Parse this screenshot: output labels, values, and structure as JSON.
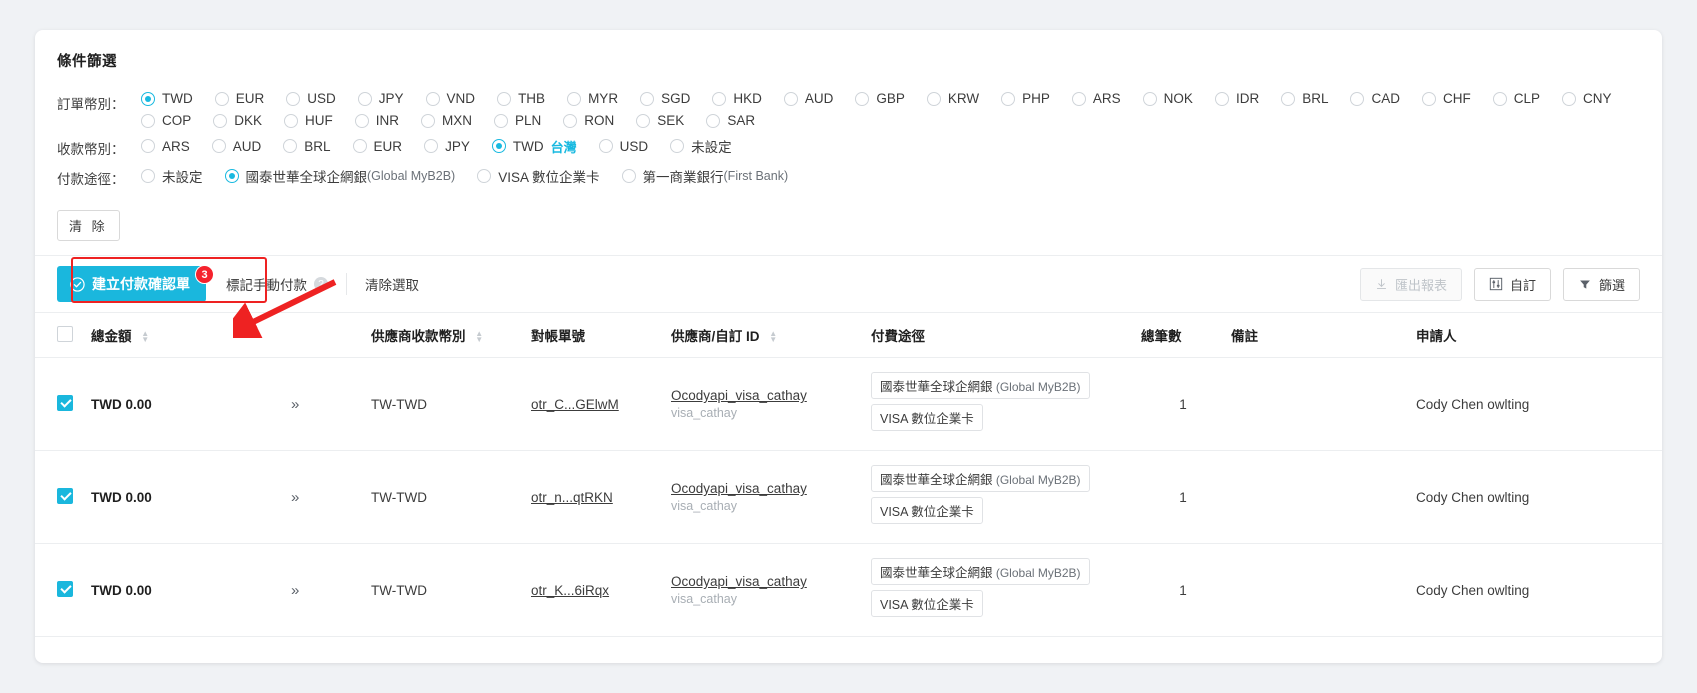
{
  "filter": {
    "title": "條件篩選",
    "order_currency_label": "訂單幣別：",
    "order_currencies": [
      {
        "code": "TWD",
        "selected": true
      },
      {
        "code": "EUR",
        "selected": false
      },
      {
        "code": "USD",
        "selected": false
      },
      {
        "code": "JPY",
        "selected": false
      },
      {
        "code": "VND",
        "selected": false
      },
      {
        "code": "THB",
        "selected": false
      },
      {
        "code": "MYR",
        "selected": false
      },
      {
        "code": "SGD",
        "selected": false
      },
      {
        "code": "HKD",
        "selected": false
      },
      {
        "code": "AUD",
        "selected": false
      },
      {
        "code": "GBP",
        "selected": false
      },
      {
        "code": "KRW",
        "selected": false
      },
      {
        "code": "PHP",
        "selected": false
      },
      {
        "code": "ARS",
        "selected": false
      },
      {
        "code": "NOK",
        "selected": false
      },
      {
        "code": "IDR",
        "selected": false
      },
      {
        "code": "BRL",
        "selected": false
      },
      {
        "code": "CAD",
        "selected": false
      },
      {
        "code": "CHF",
        "selected": false
      },
      {
        "code": "CLP",
        "selected": false
      },
      {
        "code": "CNY",
        "selected": false
      },
      {
        "code": "COP",
        "selected": false
      },
      {
        "code": "DKK",
        "selected": false
      },
      {
        "code": "HUF",
        "selected": false
      },
      {
        "code": "INR",
        "selected": false
      },
      {
        "code": "MXN",
        "selected": false
      },
      {
        "code": "PLN",
        "selected": false
      },
      {
        "code": "RON",
        "selected": false
      },
      {
        "code": "SEK",
        "selected": false
      },
      {
        "code": "SAR",
        "selected": false
      }
    ],
    "receive_currency_label": "收款幣別：",
    "receive_currencies": [
      {
        "code": "ARS",
        "selected": false,
        "tag": ""
      },
      {
        "code": "AUD",
        "selected": false,
        "tag": ""
      },
      {
        "code": "BRL",
        "selected": false,
        "tag": ""
      },
      {
        "code": "EUR",
        "selected": false,
        "tag": ""
      },
      {
        "code": "JPY",
        "selected": false,
        "tag": ""
      },
      {
        "code": "TWD",
        "selected": true,
        "tag": "台灣"
      },
      {
        "code": "USD",
        "selected": false,
        "tag": ""
      },
      {
        "code": "未設定",
        "selected": false,
        "tag": ""
      }
    ],
    "payment_route_label": "付款途徑：",
    "payment_routes": [
      {
        "zh": "未設定",
        "en": "",
        "selected": false
      },
      {
        "zh": "國泰世華全球企網銀",
        "en": "(Global MyB2B)",
        "selected": true
      },
      {
        "zh": "VISA 數位企業卡",
        "en": "",
        "selected": false
      },
      {
        "zh": "第一商業銀行",
        "en": "(First Bank)",
        "selected": false
      }
    ],
    "clear_button": "清 除"
  },
  "toolbar": {
    "create_payment_label": "建立付款確認單",
    "create_payment_badge": "3",
    "mark_manual_label": "標記手動付款",
    "help_icon": "?",
    "clear_selection_label": "清除選取",
    "export_label": "匯出報表",
    "customize_label": "自訂",
    "filter_label": "篩選",
    "accent_color": "#1ab7dd",
    "badge_color": "#f5222d",
    "annotation_color": "#ee2222"
  },
  "table": {
    "headers": [
      {
        "label": "",
        "sortable": false
      },
      {
        "label": "總金額",
        "sortable": true
      },
      {
        "label": "",
        "sortable": false
      },
      {
        "label": "供應商收款幣別",
        "sortable": true
      },
      {
        "label": "對帳單號",
        "sortable": false
      },
      {
        "label": "供應商/自訂 ID",
        "sortable": true
      },
      {
        "label": "付費途徑",
        "sortable": false
      },
      {
        "label": "總筆數",
        "sortable": false
      },
      {
        "label": "備註",
        "sortable": false
      },
      {
        "label": "申請人",
        "sortable": false
      }
    ],
    "rows": [
      {
        "checked": true,
        "amount": "TWD 0.00",
        "expand": "»",
        "supplier_currency": "TW-TWD",
        "statement_no": "otr_C...GElwM",
        "supplier_name": "Ocodyapi_visa_cathay",
        "supplier_id": "visa_cathay",
        "routes": [
          {
            "zh": "國泰世華全球企網銀",
            "en": "(Global MyB2B)"
          },
          {
            "zh": "VISA 數位企業卡",
            "en": ""
          }
        ],
        "count": "1",
        "note": "",
        "applicant": "Cody Chen owlting"
      },
      {
        "checked": true,
        "amount": "TWD 0.00",
        "expand": "»",
        "supplier_currency": "TW-TWD",
        "statement_no": "otr_n...qtRKN",
        "supplier_name": "Ocodyapi_visa_cathay",
        "supplier_id": "visa_cathay",
        "routes": [
          {
            "zh": "國泰世華全球企網銀",
            "en": "(Global MyB2B)"
          },
          {
            "zh": "VISA 數位企業卡",
            "en": ""
          }
        ],
        "count": "1",
        "note": "",
        "applicant": "Cody Chen owlting"
      },
      {
        "checked": true,
        "amount": "TWD 0.00",
        "expand": "»",
        "supplier_currency": "TW-TWD",
        "statement_no": "otr_K...6iRqx",
        "supplier_name": "Ocodyapi_visa_cathay",
        "supplier_id": "visa_cathay",
        "routes": [
          {
            "zh": "國泰世華全球企網銀",
            "en": "(Global MyB2B)"
          },
          {
            "zh": "VISA 數位企業卡",
            "en": ""
          }
        ],
        "count": "1",
        "note": "",
        "applicant": "Cody Chen owlting"
      }
    ]
  }
}
